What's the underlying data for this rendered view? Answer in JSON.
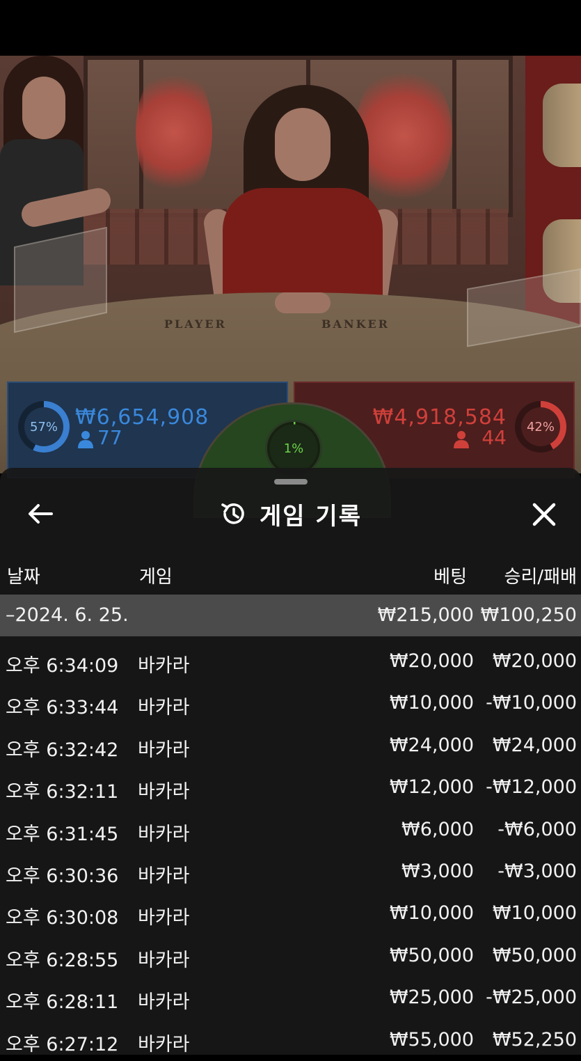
{
  "video": {
    "table_labels": {
      "player": "PLAYER",
      "banker": "BANKER"
    }
  },
  "bets": {
    "player": {
      "percent": "57%",
      "percent_value": 0.57,
      "amount": "₩6,654,908",
      "players": "77",
      "color": "#3a7fd0"
    },
    "tie": {
      "percent": "1%",
      "percent_value": 0.01,
      "color": "#6cd24a"
    },
    "banker": {
      "percent": "42%",
      "percent_value": 0.42,
      "amount": "₩4,918,584",
      "players": "44",
      "color": "#d0403a"
    }
  },
  "sheet": {
    "title": "게임 기록",
    "icons": {
      "back": "arrow-left-icon",
      "history": "history-icon",
      "close": "close-icon"
    },
    "columns": {
      "date": "날짜",
      "game": "게임",
      "bet": "베팅",
      "winloss": "승리/패배"
    },
    "date_group": {
      "date": "–2024. 6. 25.",
      "bet_total": "₩215,000",
      "winloss_total": "₩100,250"
    },
    "rows": [
      {
        "time": "오후 6:34:09",
        "game": "바카라",
        "bet": "₩20,000",
        "result": "₩20,000"
      },
      {
        "time": "오후 6:33:44",
        "game": "바카라",
        "bet": "₩10,000",
        "result": "-₩10,000"
      },
      {
        "time": "오후 6:32:42",
        "game": "바카라",
        "bet": "₩24,000",
        "result": "₩24,000"
      },
      {
        "time": "오후 6:32:11",
        "game": "바카라",
        "bet": "₩12,000",
        "result": "-₩12,000"
      },
      {
        "time": "오후 6:31:45",
        "game": "바카라",
        "bet": "₩6,000",
        "result": "-₩6,000"
      },
      {
        "time": "오후 6:30:36",
        "game": "바카라",
        "bet": "₩3,000",
        "result": "-₩3,000"
      },
      {
        "time": "오후 6:30:08",
        "game": "바카라",
        "bet": "₩10,000",
        "result": "₩10,000"
      },
      {
        "time": "오후 6:28:55",
        "game": "바카라",
        "bet": "₩50,000",
        "result": "₩50,000"
      },
      {
        "time": "오후 6:28:11",
        "game": "바카라",
        "bet": "₩25,000",
        "result": "-₩25,000"
      },
      {
        "time": "오후 6:27:12",
        "game": "바카라",
        "bet": "₩55,000",
        "result": "₩52,250"
      }
    ]
  }
}
